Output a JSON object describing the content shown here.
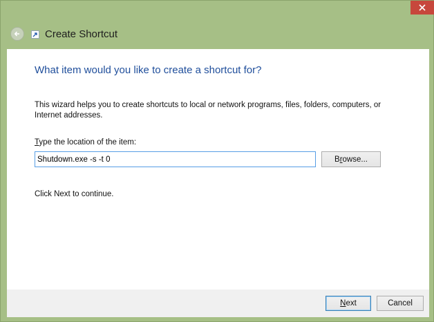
{
  "window": {
    "title": "Create Shortcut",
    "close_icon": "close-icon",
    "back_icon": "back-arrow-icon",
    "app_icon": "shortcut-icon"
  },
  "wizard": {
    "heading": "What item would you like to create a shortcut for?",
    "description": "This wizard helps you to create shortcuts to local or network programs, files, folders, computers, or Internet addresses.",
    "location_label_accel": "T",
    "location_label_rest": "ype the location of the item:",
    "location_value": "Shutdown.exe -s -t 0",
    "browse_accel": "r",
    "browse_pre": "B",
    "browse_post": "owse...",
    "continue_text": "Click Next to continue."
  },
  "footer": {
    "next_accel": "N",
    "next_rest": "ext",
    "cancel_label": "Cancel"
  },
  "colors": {
    "frame": "#a6bf86",
    "close_button": "#c7473c",
    "heading": "#1f4e9b",
    "input_focus_border": "#569de5"
  }
}
